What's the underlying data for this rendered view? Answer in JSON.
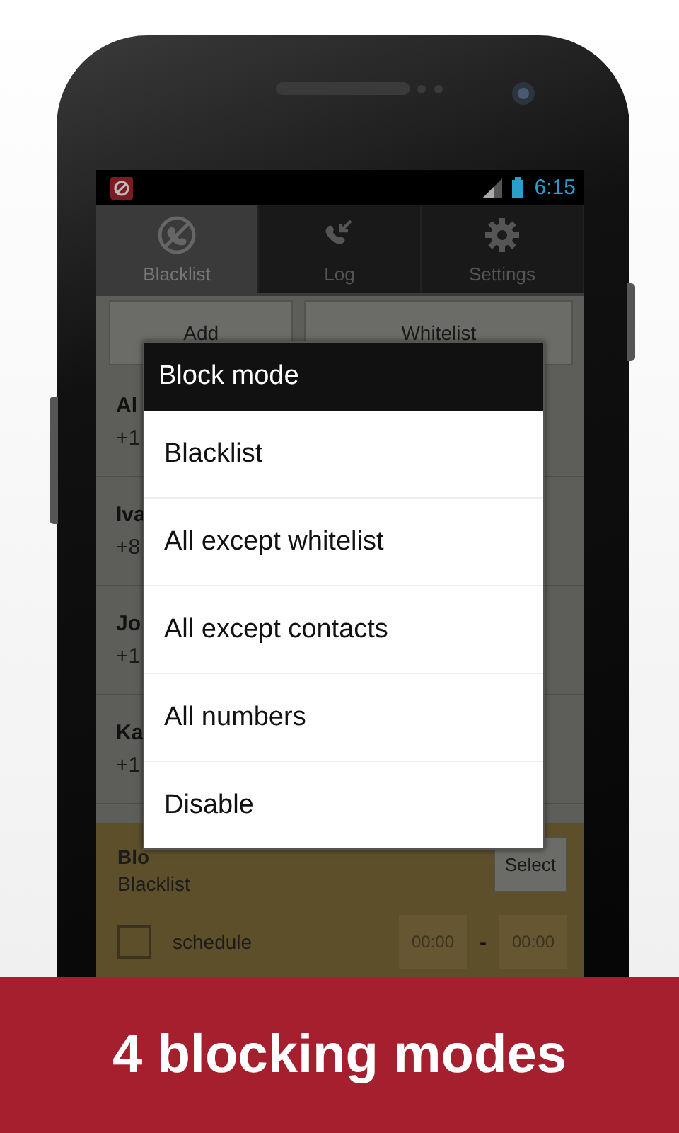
{
  "status_bar": {
    "time": "6:15"
  },
  "tabs": [
    {
      "label": "Blacklist",
      "selected": true
    },
    {
      "label": "Log",
      "selected": false
    },
    {
      "label": "Settings",
      "selected": false
    }
  ],
  "buttons": [
    "Add",
    "Whitelist"
  ],
  "contacts": [
    {
      "name": "Al",
      "number": "+1"
    },
    {
      "name": "Iva",
      "number": "+8"
    },
    {
      "name": "Jo",
      "number": "+1"
    },
    {
      "name": "Ka",
      "number": "+1"
    }
  ],
  "mode_panel": {
    "title": "Blo",
    "value": "Blacklist",
    "select_button": "Select",
    "schedule": {
      "label": "schedule",
      "checked": false,
      "start": "00:00",
      "separator": "-",
      "end": "00:00"
    }
  },
  "dialog": {
    "title": "Block mode",
    "options": [
      "Blacklist",
      "All except whitelist",
      "All except contacts",
      "All numbers",
      "Disable"
    ]
  },
  "banner": "4 blocking modes"
}
